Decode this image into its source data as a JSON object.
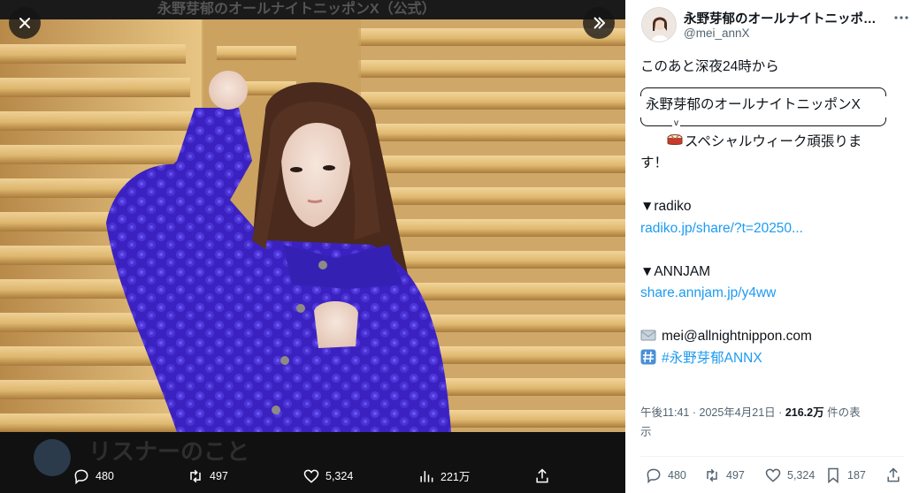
{
  "viewer": {
    "background_title": "永野芽郁のオールナイトニッポンX（公式）",
    "behind_text": "リスナーのこと",
    "actions": {
      "replies": "480",
      "reposts": "497",
      "likes": "5,324",
      "views": "221万"
    }
  },
  "tweet": {
    "display_name": "永野芽郁のオールナイトニッポ…",
    "handle": "@mei_annX",
    "body": {
      "line1": "このあと深夜24時から",
      "frame_title": "永野芽郁のオールナイトニッポンX",
      "frame_tail": "v",
      "line_special_a": "スペシャルウィーク頑張りま",
      "line_special_b": "す！",
      "radiko_label": "▼radiko",
      "radiko_link": "radiko.jp/share/?t=20250...",
      "annjam_label": "▼ANNJAM",
      "annjam_link": "share.annjam.jp/y4ww",
      "email": "mei@allnightnippon.com",
      "hashtag": "#永野芽郁ANNX"
    },
    "meta": {
      "time": "午後11:41",
      "dot1": "·",
      "date": "2025年4月21日",
      "dot2": "·",
      "views": "216.2万",
      "views_suffix": " 件の表",
      "views_suffix2": "示"
    },
    "actions": {
      "replies": "480",
      "reposts": "497",
      "likes": "5,324",
      "bookmarks": "187"
    }
  },
  "colors": {
    "link": "#1d9bf0",
    "muted": "#536471",
    "sweater": "#3c23c8",
    "wall": "#d9b87c"
  }
}
